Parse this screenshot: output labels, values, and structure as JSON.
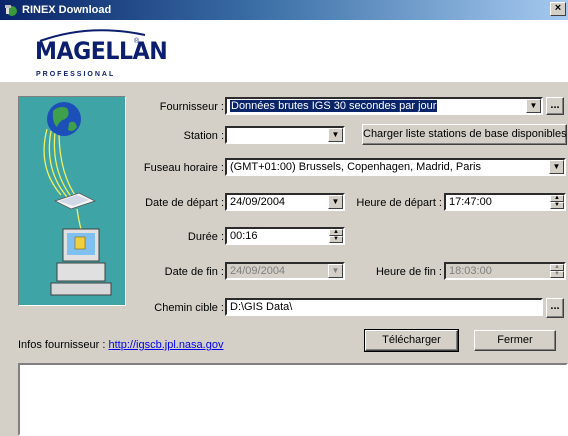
{
  "window": {
    "title": "RINEX Download",
    "close_label": "×"
  },
  "logo": {
    "brand": "MAGELLAN",
    "reg": "®",
    "subtitle": "PROFESSIONAL"
  },
  "form": {
    "fournisseur": {
      "label": "Fournisseur :",
      "value": "Données brutes IGS 30 secondes par jour",
      "browse_label": "..."
    },
    "station": {
      "label": "Station :",
      "value": "",
      "load_button": "Charger liste stations de base disponibles"
    },
    "fuseau": {
      "label": "Fuseau horaire :",
      "value": "(GMT+01:00) Brussels, Copenhagen, Madrid, Paris"
    },
    "date_depart": {
      "label": "Date de départ :",
      "value": "24/09/2004"
    },
    "heure_depart": {
      "label": "Heure de départ :",
      "value": "17:47:00"
    },
    "duree": {
      "label": "Durée :",
      "value": "00:16"
    },
    "date_fin": {
      "label": "Date de fin :",
      "value": "24/09/2004"
    },
    "heure_fin": {
      "label": "Heure de fin :",
      "value": "18:03:00"
    },
    "chemin": {
      "label": "Chemin cible :",
      "value": "D:\\GIS Data\\",
      "browse_label": "..."
    }
  },
  "infos": {
    "label": "Infos fournisseur :",
    "link": "http://igscb.jpl.nasa.gov"
  },
  "buttons": {
    "download": "Télécharger",
    "close": "Fermer"
  },
  "icons": {
    "dropdown": "▼",
    "spin_up": "▲",
    "spin_down": "▼"
  },
  "colors": {
    "accent": "#0a246a",
    "panel_bg": "#3ea4a6",
    "face": "#d4d0c8"
  }
}
